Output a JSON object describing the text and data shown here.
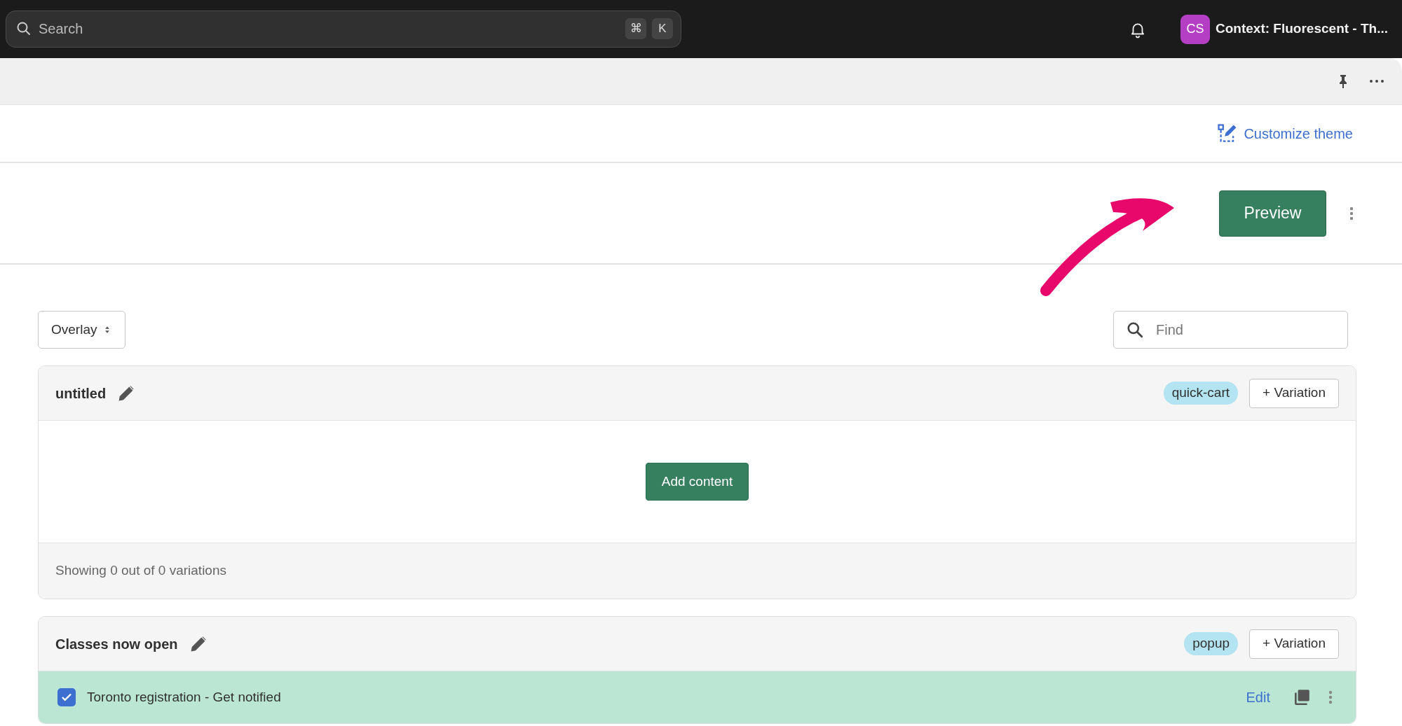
{
  "topbar": {
    "search": {
      "placeholder": "Search",
      "shortcut_keys": [
        "⌘",
        "K"
      ]
    },
    "account": {
      "initials": "CS",
      "label": "Context: Fluorescent - Th..."
    }
  },
  "customize_link": "Customize theme",
  "preview_button": "Preview",
  "view_select": {
    "value": "Overlay"
  },
  "find": {
    "placeholder": "Find"
  },
  "groups": [
    {
      "title": "untitled",
      "tag": "quick-cart",
      "add_button": "+ Variation",
      "empty_action": "Add content",
      "footer": "Showing 0 out of 0 variations"
    },
    {
      "title": "Classes now open",
      "tag": "popup",
      "add_button": "+ Variation",
      "variations": [
        {
          "name": "Toronto registration - Get notified",
          "checked": true,
          "edit": "Edit"
        }
      ]
    }
  ]
}
